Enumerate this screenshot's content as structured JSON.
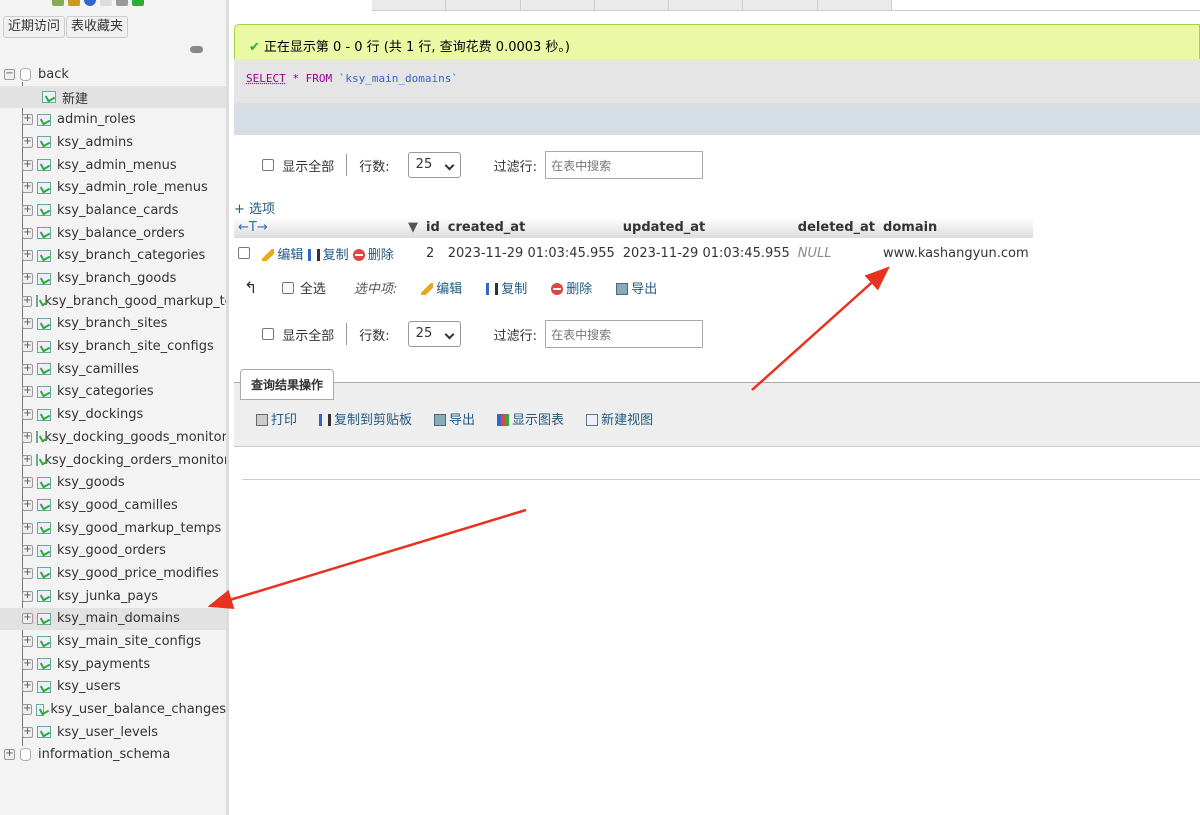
{
  "sidebar": {
    "recent_button": "近期访问",
    "favorites_button": "表收藏夹",
    "databases": [
      {
        "name": "back",
        "new_label": "新建",
        "tables": [
          "admin_roles",
          "ksy_admins",
          "ksy_admin_menus",
          "ksy_admin_role_menus",
          "ksy_balance_cards",
          "ksy_balance_orders",
          "ksy_branch_categories",
          "ksy_branch_goods",
          "ksy_branch_good_markup_temps",
          "ksy_branch_sites",
          "ksy_branch_site_configs",
          "ksy_camilles",
          "ksy_categories",
          "ksy_dockings",
          "ksy_docking_goods_monitors",
          "ksy_docking_orders_monitors",
          "ksy_goods",
          "ksy_good_camilles",
          "ksy_good_markup_temps",
          "ksy_good_orders",
          "ksy_good_price_modifies",
          "ksy_junka_pays",
          "ksy_main_domains",
          "ksy_main_site_configs",
          "ksy_payments",
          "ksy_users",
          "ksy_user_balance_changes",
          "ksy_user_levels"
        ],
        "selected_table": "ksy_main_domains"
      },
      {
        "name": "information_schema"
      }
    ]
  },
  "main": {
    "success_message": "正在显示第 0 - 0 行 (共 1 行, 查询花费 0.0003 秒。)",
    "sql": {
      "select": "SELECT",
      "star": "*",
      "from": "FROM",
      "table": "`ksy_main_domains`"
    },
    "nav": {
      "show_all": "显示全部",
      "rows_label": "行数:",
      "rows_value": "25",
      "filter_label": "过滤行:",
      "filter_placeholder": "在表中搜索"
    },
    "options_link": "+ 选项",
    "columns": [
      "id",
      "created_at",
      "updated_at",
      "deleted_at",
      "domain"
    ],
    "rows": [
      {
        "id": "2",
        "created_at": "2023-11-29 01:03:45.955",
        "updated_at": "2023-11-29 01:03:45.955",
        "deleted_at": "NULL",
        "domain": "www.kashangyun.com"
      }
    ],
    "row_actions": {
      "edit": "编辑",
      "copy": "复制",
      "delete": "删除"
    },
    "bulk": {
      "select_all": "全选",
      "with_selected": "选中项:",
      "edit": "编辑",
      "copy": "复制",
      "delete": "删除",
      "export": "导出"
    },
    "query_ops": {
      "title": "查询结果操作",
      "print": "打印",
      "copy_clipboard": "复制到剪贴板",
      "export": "导出",
      "chart": "显示图表",
      "create_view": "新建视图"
    }
  },
  "colors": {
    "success_bg": "#ebf8a4",
    "annotation_arrow": "#e8321e",
    "link": "#235a81"
  }
}
